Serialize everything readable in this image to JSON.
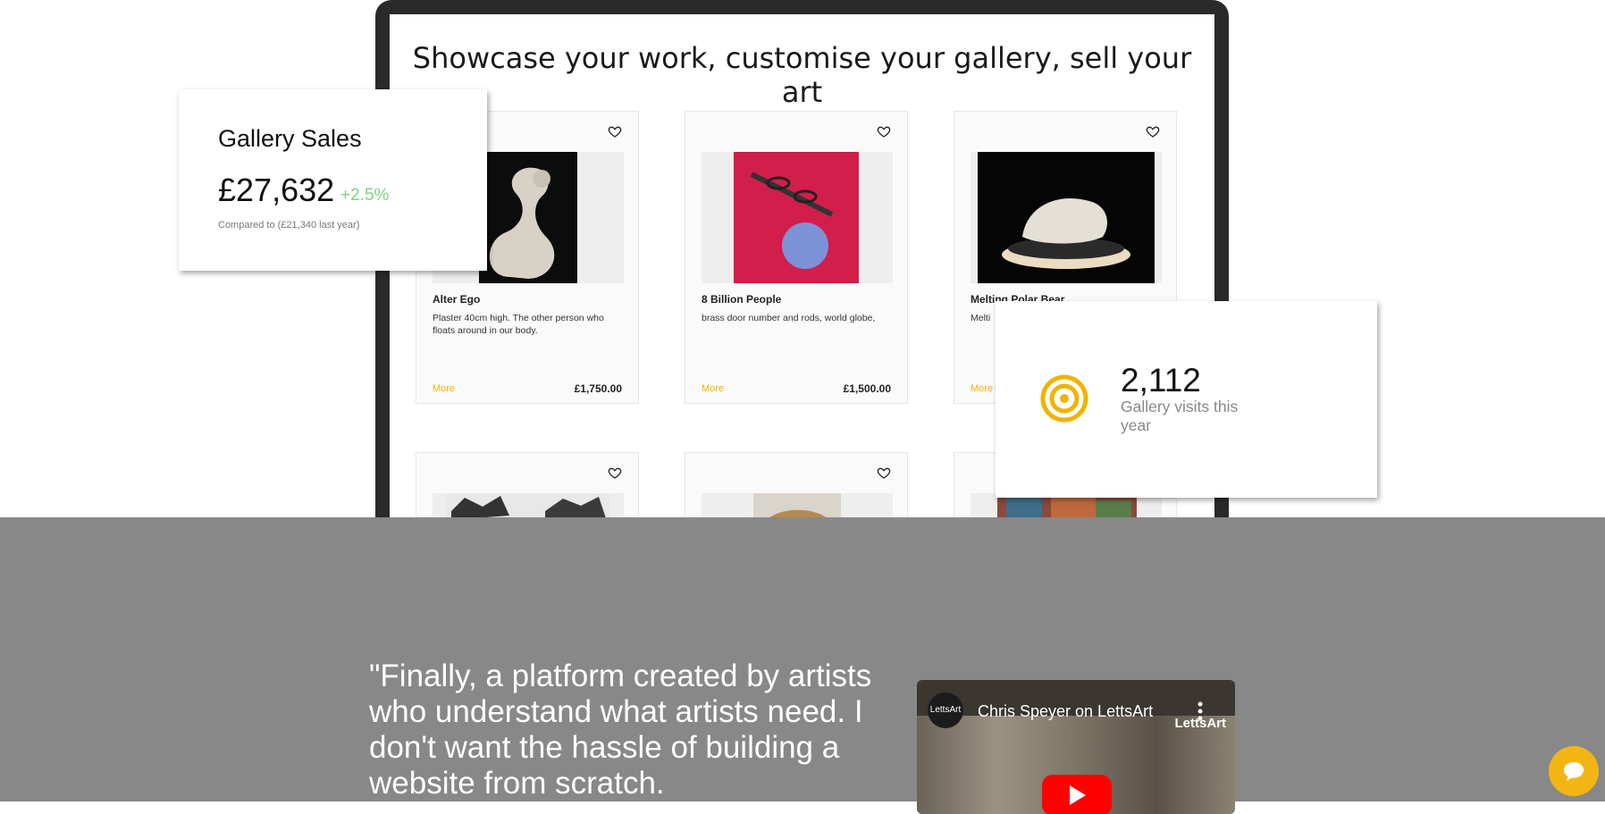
{
  "showcase": {
    "title": "Showcase your work, customise your gallery, sell your art",
    "cards": [
      {
        "title": "Alter Ego",
        "desc": "Plaster 40cm high. The other person who floats around in our body.",
        "more": "More",
        "price": "£1,750.00"
      },
      {
        "title": "8 Billion People",
        "desc": "brass door number and rods,  world globe,",
        "more": "More",
        "price": "£1,500.00"
      },
      {
        "title": "Melting Polar Bear",
        "desc": "Melti",
        "more": "More",
        "price": ""
      }
    ]
  },
  "sales_card": {
    "title": "Gallery Sales",
    "amount": "£27,632",
    "change": "+2.5%",
    "note": "Compared to (£21,340 last year)"
  },
  "visits_card": {
    "count": "2,112",
    "label": "Gallery visits this year",
    "icon": "target-icon"
  },
  "testimonial": {
    "quote": "\"Finally, a platform created by artists who understand what artists need. I don't want the hassle of building a website from scratch."
  },
  "video": {
    "channel": "LettsArt",
    "title": "Chris Speyer on LettsArt",
    "watermark": "LettsArt"
  },
  "colors": {
    "accent": "#f0b400",
    "positive": "#7fd27f",
    "testimonial_bg": "#888888"
  }
}
